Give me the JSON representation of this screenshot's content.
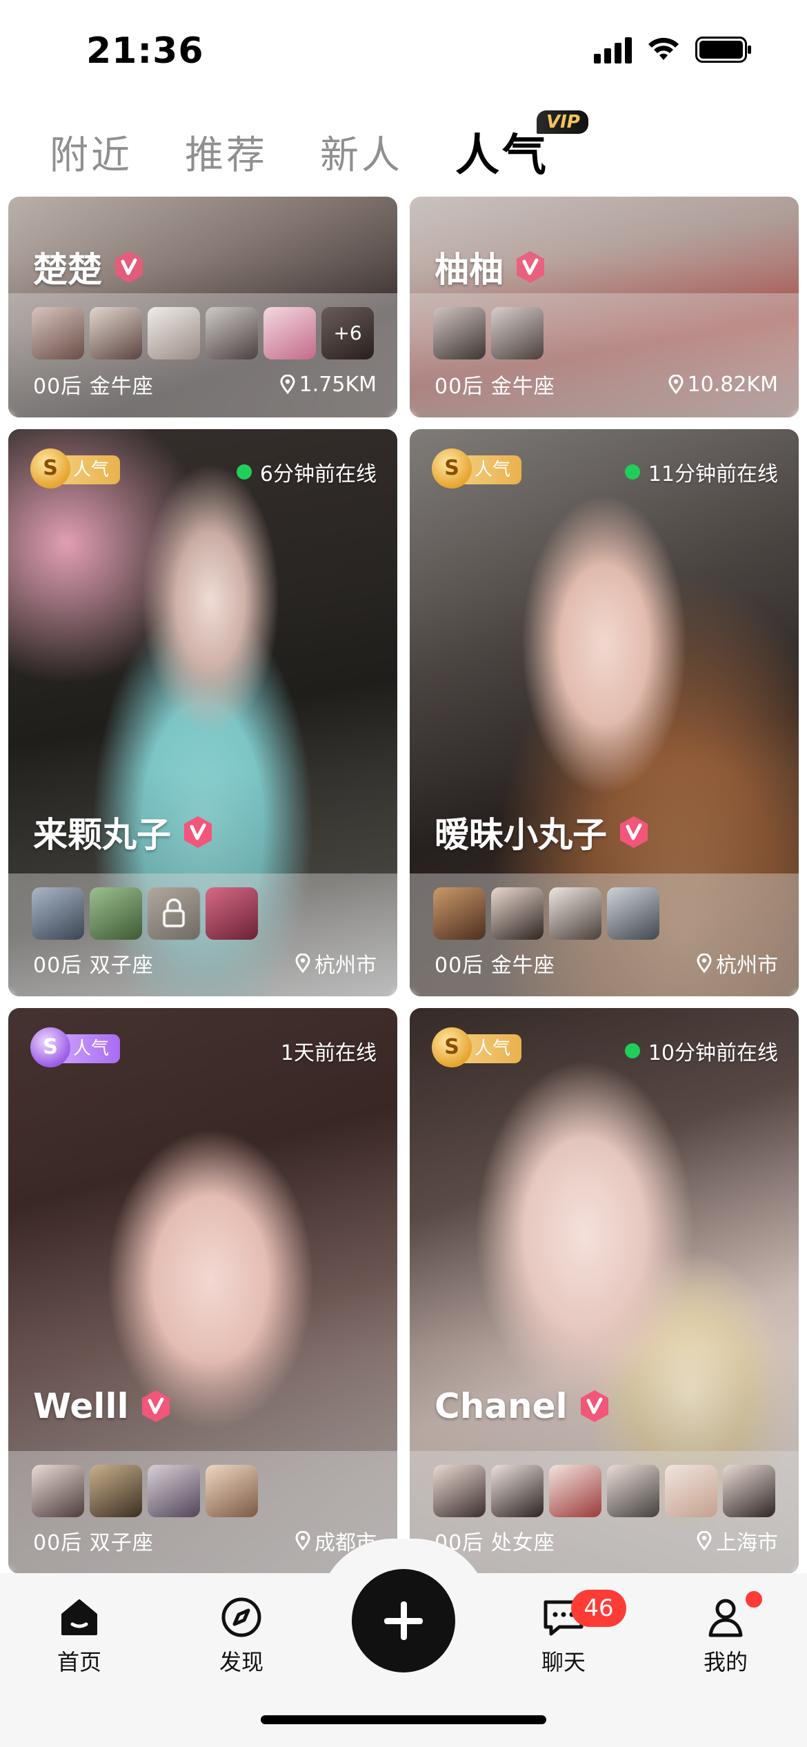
{
  "status_bar": {
    "time": "21:36"
  },
  "tabs": [
    {
      "label": "附近",
      "active": false
    },
    {
      "label": "推荐",
      "active": false
    },
    {
      "label": "新人",
      "active": false
    },
    {
      "label": "人气",
      "active": true,
      "badge": "VIP"
    }
  ],
  "cards": [
    {
      "name": "楚楚",
      "verified_icon": "v-badge-icon",
      "meta": "00后 金牛座",
      "location": "1.75KM",
      "thumb_more": "+6",
      "thumb_count": 6
    },
    {
      "name": "柚柚",
      "verified_icon": "v-badge-icon",
      "meta": "00后 金牛座",
      "location": "10.82KM",
      "thumb_count": 2
    },
    {
      "name": "来颗丸子",
      "verified_icon": "v-badge-icon",
      "badge": "人气",
      "online": "6分钟前在线",
      "meta": "00后 双子座",
      "location": "杭州市",
      "thumb_count": 4,
      "locked_thumb": 3
    },
    {
      "name": "暧昧小丸子",
      "verified_icon": "v-badge-icon",
      "badge": "人气",
      "online": "11分钟前在线",
      "meta": "00后 金牛座",
      "location": "杭州市",
      "thumb_count": 4
    },
    {
      "name": "Welll",
      "verified_icon": "v-badge-icon",
      "badge": "人气",
      "online": "1天前在线",
      "meta": "00后 双子座",
      "location": "成都市",
      "thumb_count": 4
    },
    {
      "name": "Chanel",
      "verified_icon": "v-badge-icon",
      "badge": "人气",
      "online": "10分钟前在线",
      "meta": "00后 处女座",
      "location": "上海市",
      "thumb_count": 6
    }
  ],
  "bottom_nav": {
    "home": "首页",
    "discover": "发现",
    "chat": "聊天",
    "chat_badge": "46",
    "me": "我的"
  },
  "colors": {
    "online": "#1fcf5a",
    "badge_red": "#ff3b36",
    "verify": "#f2567a"
  }
}
